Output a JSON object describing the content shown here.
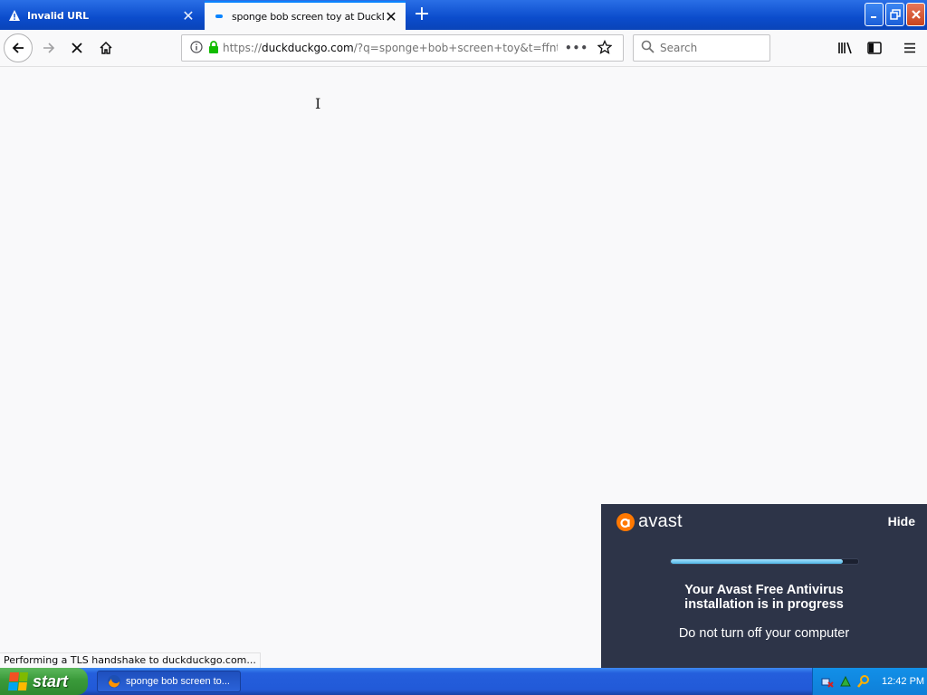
{
  "tabs": [
    {
      "title": "Invalid URL",
      "icon": "warning-icon",
      "state": "inactive"
    },
    {
      "title": "sponge bob screen toy at DuckDuckGo",
      "icon": "loading-icon",
      "state": "active"
    }
  ],
  "navbar": {
    "url": "https://duckduckgo.com/?q=sponge+bob+screen+toy&t=ffnt",
    "url_host": "duckduckgo.com",
    "url_prefix": "https://",
    "url_rest": "/?q=sponge+bob+screen+toy&t=ffnt",
    "search_placeholder": "Search"
  },
  "status_text": "Performing a TLS handshake to duckduckgo.com...",
  "avast": {
    "logo": "avast",
    "hide_label": "Hide",
    "title_line1": "Your Avast Free Antivirus",
    "title_line2": "installation is in progress",
    "subtitle": "Do not turn off your computer",
    "progress": 0.92
  },
  "taskbar": {
    "start_label": "start",
    "task_label": "sponge bob screen to...",
    "clock": "12:42 PM"
  },
  "colors": {
    "titlebar": "#0b4ccc",
    "avast_bg": "#2d3448",
    "avast_orange": "#ff7800",
    "lock_green": "#12bc00"
  }
}
